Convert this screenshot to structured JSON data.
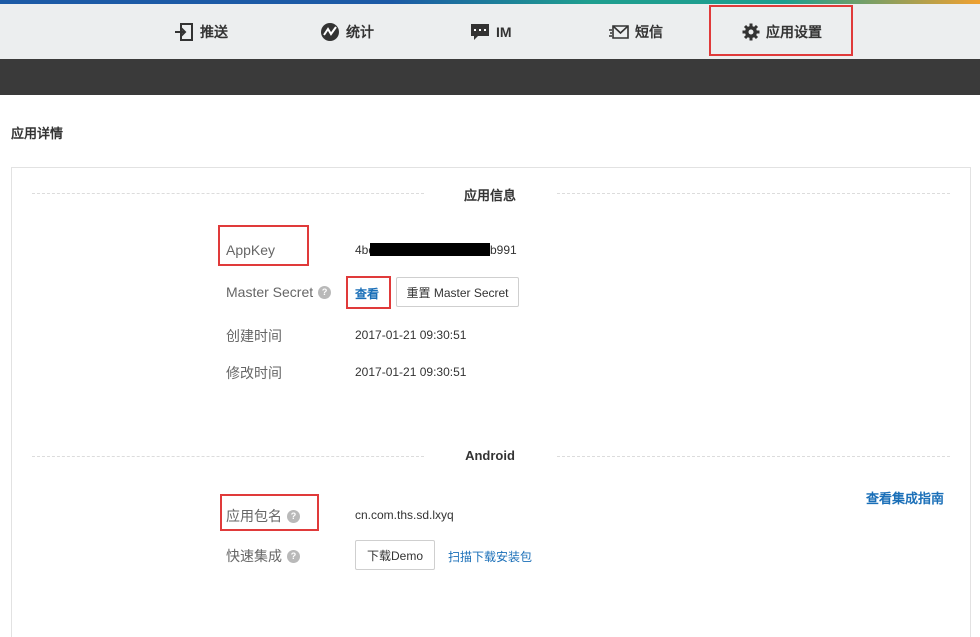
{
  "nav": {
    "items": [
      {
        "label": "推送",
        "icon": "push-icon"
      },
      {
        "label": "统计",
        "icon": "stats-icon"
      },
      {
        "label": "IM",
        "icon": "chat-icon"
      },
      {
        "label": "短信",
        "icon": "sms-icon"
      },
      {
        "label": "应用设置",
        "icon": "gear-icon"
      }
    ],
    "active": "应用设置"
  },
  "page": {
    "title": "应用详情"
  },
  "app_info": {
    "section_title": "应用信息",
    "appkey_label": "AppKey",
    "appkey_prefix": "4bd",
    "appkey_suffix": "b991",
    "master_secret_label": "Master Secret",
    "view_label": "查看",
    "reset_label": "重置 Master Secret",
    "created_label": "创建时间",
    "created_value": "2017-01-21 09:30:51",
    "modified_label": "修改时间",
    "modified_value": "2017-01-21 09:30:51"
  },
  "android": {
    "section_title": "Android",
    "guide_link": "查看集成指南",
    "package_label": "应用包名",
    "package_value": "cn.com.ths.sd.lxyq",
    "quick_label": "快速集成",
    "download_demo": "下载Demo",
    "scan_link": "扫描下载安装包"
  },
  "help_glyph": "?",
  "colors": {
    "accent_link": "#1a6fb8",
    "highlight_box": "#e03a3a",
    "dark_bar": "#3a3a3a",
    "nav_bg": "#eceeef"
  }
}
